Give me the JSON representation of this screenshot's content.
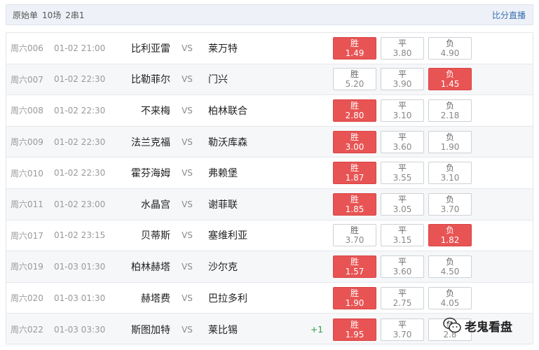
{
  "header": {
    "title": "原始单",
    "matches": "10场",
    "combo": "2串1",
    "live_link": "比分直播"
  },
  "labels": {
    "vs": "VS",
    "win": "胜",
    "draw": "平",
    "lose": "负"
  },
  "matches": [
    {
      "num": "周六006",
      "time": "01-02 21:00",
      "home": "比利亚雷",
      "away": "莱万特",
      "handicap": "",
      "odds": [
        "1.49",
        "3.80",
        "4.90"
      ],
      "selected": 0
    },
    {
      "num": "周六007",
      "time": "01-02 22:30",
      "home": "比勒菲尔",
      "away": "门兴",
      "handicap": "",
      "odds": [
        "5.20",
        "3.90",
        "1.45"
      ],
      "selected": 2
    },
    {
      "num": "周六008",
      "time": "01-02 22:30",
      "home": "不来梅",
      "away": "柏林联合",
      "handicap": "",
      "odds": [
        "2.80",
        "3.10",
        "2.18"
      ],
      "selected": 0
    },
    {
      "num": "周六009",
      "time": "01-02 22:30",
      "home": "法兰克福",
      "away": "勒沃库森",
      "handicap": "",
      "odds": [
        "3.00",
        "3.60",
        "1.90"
      ],
      "selected": 0
    },
    {
      "num": "周六010",
      "time": "01-02 22:30",
      "home": "霍芬海姆",
      "away": "弗赖堡",
      "handicap": "",
      "odds": [
        "1.87",
        "3.55",
        "3.10"
      ],
      "selected": 0
    },
    {
      "num": "周六011",
      "time": "01-02 23:00",
      "home": "水晶宫",
      "away": "谢菲联",
      "handicap": "",
      "odds": [
        "1.85",
        "3.05",
        "3.70"
      ],
      "selected": 0
    },
    {
      "num": "周六017",
      "time": "01-02 23:15",
      "home": "贝蒂斯",
      "away": "塞维利亚",
      "handicap": "",
      "odds": [
        "3.70",
        "3.15",
        "1.82"
      ],
      "selected": 2
    },
    {
      "num": "周六019",
      "time": "01-03 01:30",
      "home": "柏林赫塔",
      "away": "沙尔克",
      "handicap": "",
      "odds": [
        "1.57",
        "3.60",
        "4.50"
      ],
      "selected": 0
    },
    {
      "num": "周六020",
      "time": "01-03 01:30",
      "home": "赫塔费",
      "away": "巴拉多利",
      "handicap": "",
      "odds": [
        "1.90",
        "2.75",
        "4.05"
      ],
      "selected": 0
    },
    {
      "num": "周六022",
      "time": "01-03 03:30",
      "home": "斯图加特",
      "away": "莱比锡",
      "handicap": "+1",
      "odds": [
        "1.95",
        "3.70",
        "2.8"
      ],
      "selected": 0
    }
  ],
  "watermark": {
    "text": "老鬼看盘"
  },
  "colors": {
    "selected": "#e85454",
    "link": "#3a6fb0",
    "handicap": "#2f9b45"
  }
}
